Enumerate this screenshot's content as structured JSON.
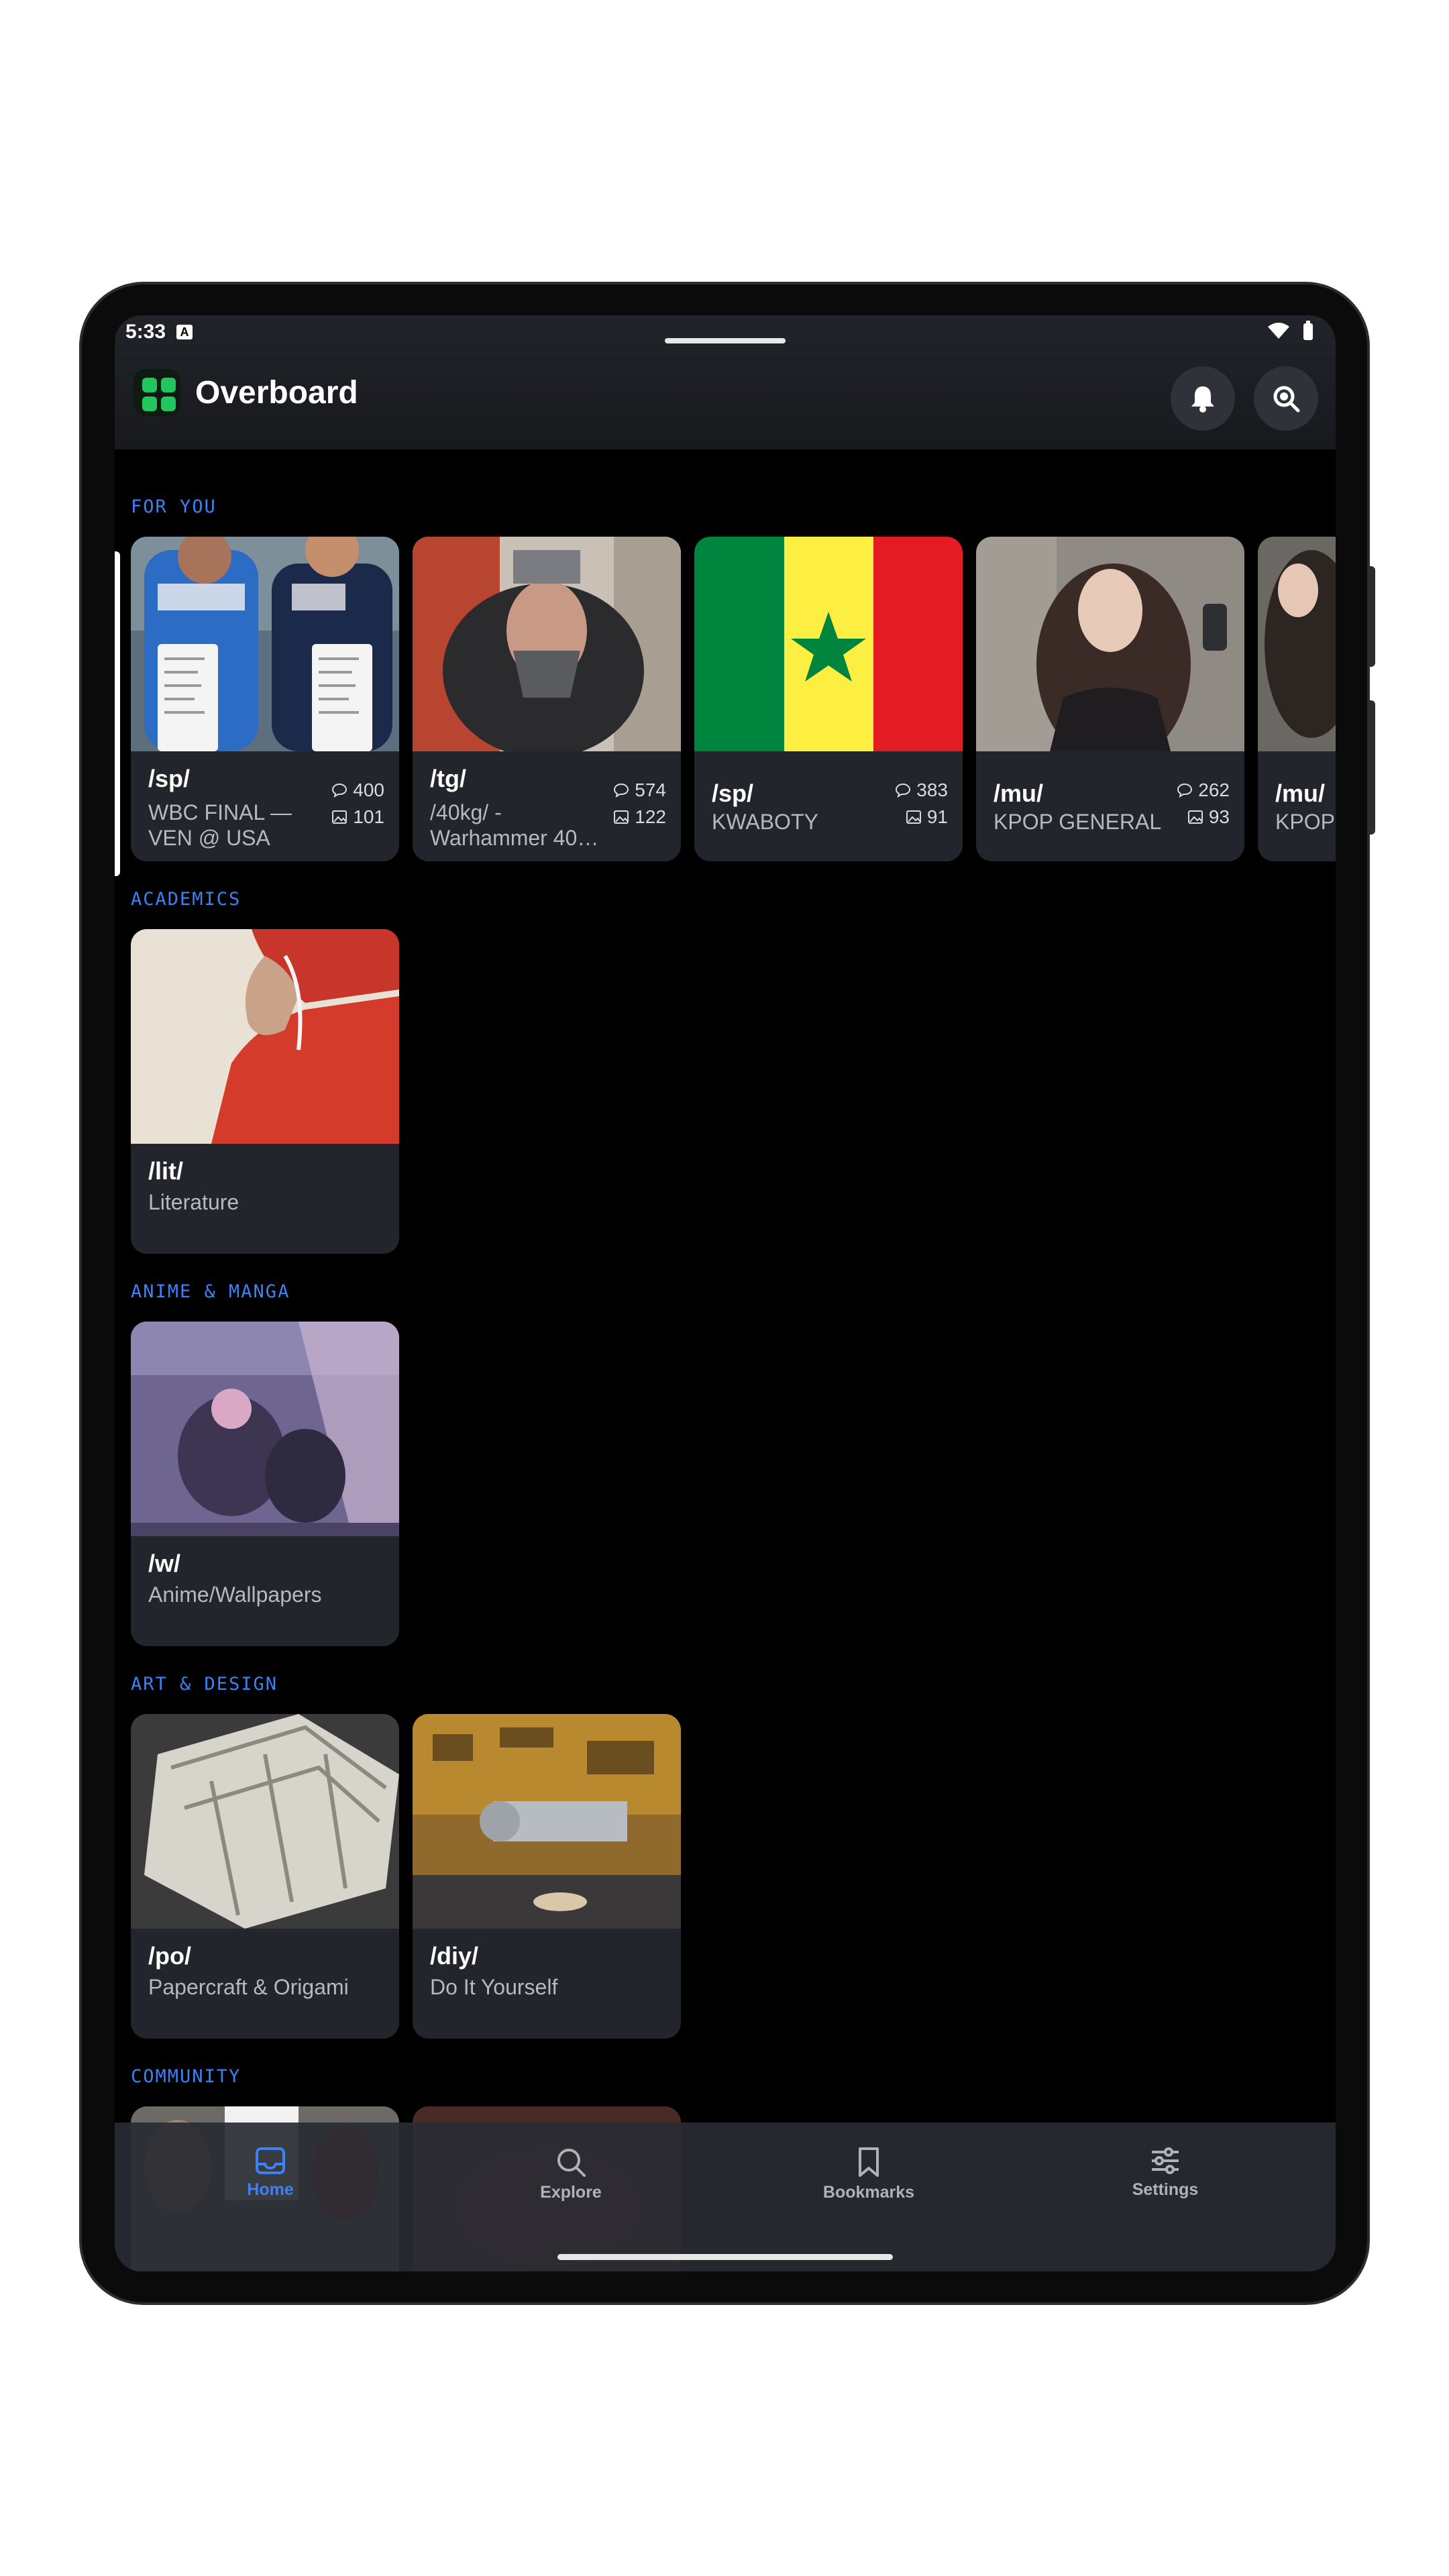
{
  "status_bar": {
    "time": "5:33",
    "indicator": "A"
  },
  "app_bar": {
    "title": "Overboard",
    "notifications_icon": "bell-icon",
    "search_icon": "search-icon"
  },
  "sections": [
    {
      "title": "FOR YOU",
      "cards": [
        {
          "board": "/sp/",
          "subtitle_line1": "WBC FINAL —",
          "subtitle_line2": "VEN @ USA",
          "replies": "400",
          "images": "101"
        },
        {
          "board": "/tg/",
          "subtitle_line1": "/40kg/ -",
          "subtitle_line2": "Warhammer 40…",
          "replies": "574",
          "images": "122"
        },
        {
          "board": "/sp/",
          "subtitle_line1": "KWABOTY",
          "replies": "383",
          "images": "91"
        },
        {
          "board": "/mu/",
          "subtitle_line1": "KPOP GENERAL",
          "replies": "262",
          "images": "93"
        },
        {
          "board": "/mu/",
          "subtitle_line1": "KPOP"
        }
      ]
    },
    {
      "title": "ACADEMICS",
      "cards": [
        {
          "board": "/lit/",
          "subtitle_line1": "Literature"
        }
      ]
    },
    {
      "title": "ANIME & MANGA",
      "cards": [
        {
          "board": "/w/",
          "subtitle_line1": "Anime/Wallpapers"
        }
      ]
    },
    {
      "title": "ART & DESIGN",
      "cards": [
        {
          "board": "/po/",
          "subtitle_line1": "Papercraft & Origami"
        },
        {
          "board": "/diy/",
          "subtitle_line1": "Do It Yourself"
        }
      ]
    },
    {
      "title": "COMMUNITY"
    }
  ],
  "bottom_nav": [
    {
      "label": "Home",
      "icon": "inbox-icon",
      "active": true
    },
    {
      "label": "Explore",
      "icon": "search-icon"
    },
    {
      "label": "Bookmarks",
      "icon": "bookmark-icon"
    },
    {
      "label": "Settings",
      "icon": "sliders-icon"
    }
  ],
  "colors": {
    "accent": "#3b82f6",
    "brand": "#22c55e",
    "card": "#22252b"
  }
}
